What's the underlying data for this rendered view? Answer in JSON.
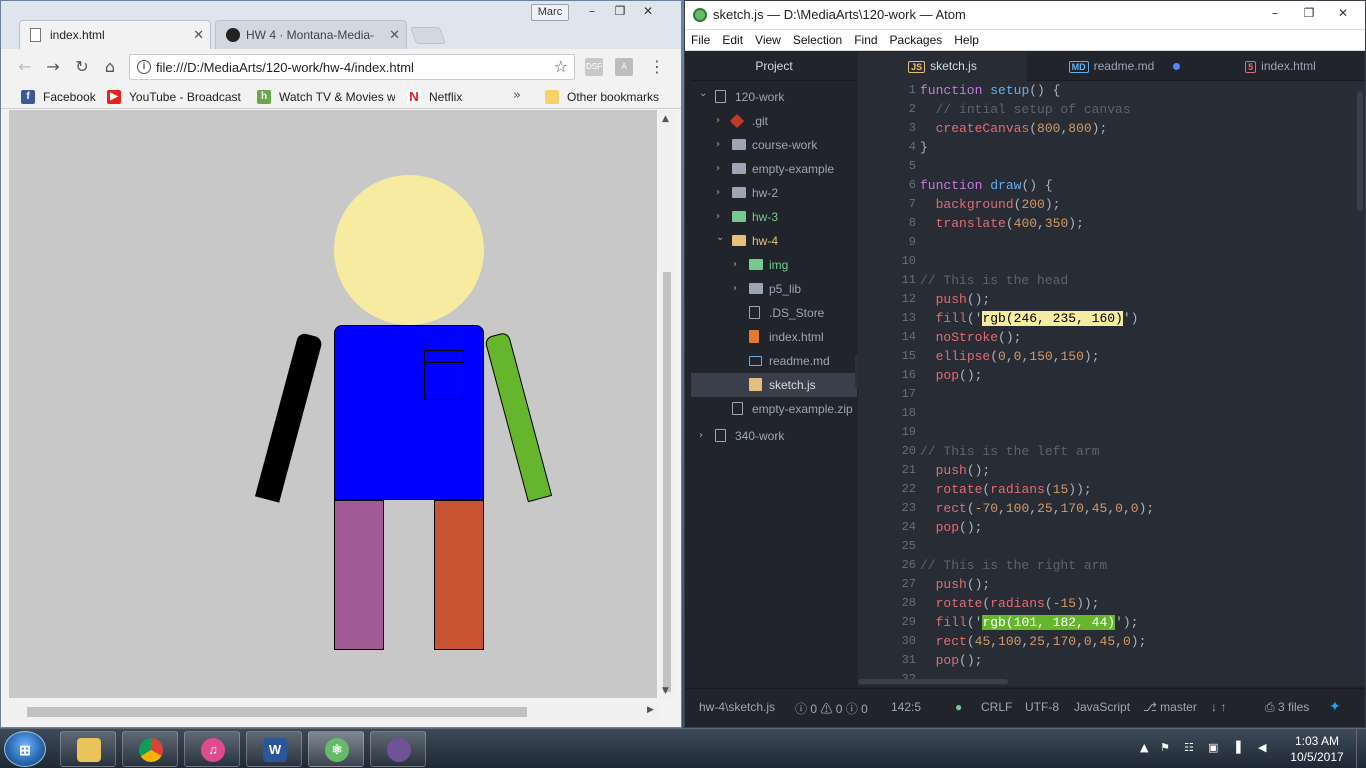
{
  "chrome": {
    "user_chip": "Marc",
    "tabs": [
      {
        "label": "index.html",
        "active": true
      },
      {
        "label": "HW 4 · Montana-Media-",
        "active": false
      }
    ],
    "address": "file:///D:/MediaArts/120-work/hw-4/index.html",
    "bookmarks": [
      "Facebook",
      "YouTube - Broadcast",
      "Watch TV & Movies w",
      "Netflix"
    ],
    "other_bookmarks": "Other bookmarks",
    "figure": {
      "head_color": "#f6eba0",
      "torso_color": "#0000ff",
      "left_arm_color": "#000000",
      "right_arm_color": "#65b62c",
      "left_leg_color": "#a05b96",
      "right_leg_color": "#c85433",
      "canvas_bg": "#c8c8c8"
    }
  },
  "atom": {
    "title": "sketch.js — D:\\MediaArts\\120-work — Atom",
    "menu": [
      "File",
      "Edit",
      "View",
      "Selection",
      "Find",
      "Packages",
      "Help"
    ],
    "tree_header": "Project",
    "tree": [
      {
        "label": "120-work",
        "type": "repo",
        "depth": 0,
        "open": true
      },
      {
        "label": ".git",
        "type": "git",
        "depth": 1
      },
      {
        "label": "course-work",
        "type": "folder",
        "depth": 1
      },
      {
        "label": "empty-example",
        "type": "folder",
        "depth": 1
      },
      {
        "label": "hw-2",
        "type": "folder",
        "depth": 1
      },
      {
        "label": "hw-3",
        "type": "folder",
        "depth": 1,
        "green": true
      },
      {
        "label": "hw-4",
        "type": "folder",
        "depth": 1,
        "open": true,
        "yellow": true
      },
      {
        "label": "img",
        "type": "folder",
        "depth": 2,
        "green": true
      },
      {
        "label": "p5_lib",
        "type": "folder",
        "depth": 2
      },
      {
        "label": ".DS_Store",
        "type": "file",
        "depth": 2
      },
      {
        "label": "index.html",
        "type": "html",
        "depth": 2
      },
      {
        "label": "readme.md",
        "type": "md",
        "depth": 2
      },
      {
        "label": "sketch.js",
        "type": "js",
        "depth": 2,
        "selected": true
      },
      {
        "label": "empty-example.zip",
        "type": "zip",
        "depth": 1
      },
      {
        "label": "340-work",
        "type": "repo",
        "depth": 0
      }
    ],
    "editor_tabs": [
      {
        "label": "sketch.js",
        "icon": "JS",
        "active": true
      },
      {
        "label": "readme.md",
        "icon": "MD",
        "modified": true
      },
      {
        "label": "index.html",
        "icon": "5"
      }
    ],
    "code_lines": [
      "function setup() {",
      "  // intial setup of canvas",
      "  createCanvas(800,800);",
      "}",
      "",
      "function draw() {",
      "  background(200);",
      "  translate(400,350);",
      "",
      "",
      "// This is the head",
      "  push();",
      "  fill('rgb(246, 235, 160)')",
      "  noStroke();",
      "  ellipse(0,0,150,150);",
      "  pop();",
      "",
      "",
      "",
      "// This is the left arm",
      "  push();",
      "  rotate(radians(15));",
      "  rect(-70,100,25,170,45,0,0);",
      "  pop();",
      "",
      "// This is the right arm",
      "  push();",
      "  rotate(radians(-15));",
      "  fill('rgb(101, 182, 44)');",
      "  rect(45,100,25,170,0,45,0);",
      "  pop();",
      ""
    ],
    "status": {
      "path": "hw-4\\sketch.js",
      "errors": "0",
      "warnings": "0",
      "infos": "0",
      "cursor": "142:5",
      "line_ending": "CRLF",
      "encoding": "UTF-8",
      "grammar": "JavaScript",
      "branch": "master",
      "files": "3 files"
    }
  },
  "taskbar": {
    "time": "1:03 AM",
    "date": "10/5/2017",
    "apps": [
      "file-explorer",
      "chrome",
      "itunes",
      "word",
      "atom",
      "github-desktop"
    ]
  }
}
